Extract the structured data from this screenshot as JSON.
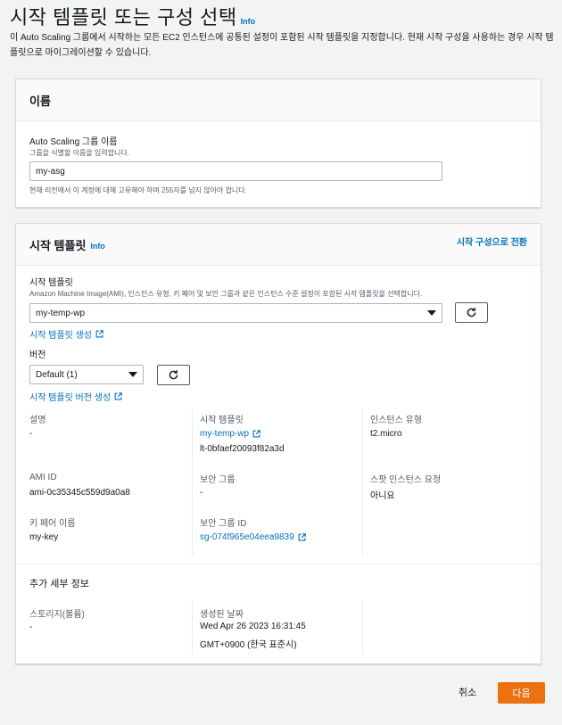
{
  "header": {
    "title": "시작 템플릿 또는 구성 선택",
    "info": "Info",
    "description": "이 Auto Scaling 그룹에서 시작하는 모든 EC2 인스턴스에 공통된 설정이 포함된 시작 템플릿을 지정합니다. 현재 시작 구성을 사용하는 경우 시작 템플릿으로 마이그레이션할 수 있습니다."
  },
  "name_panel": {
    "title": "이름",
    "field_label": "Auto Scaling 그룹 이름",
    "field_sublabel": "그룹을 식별할 이름을 입력합니다.",
    "field_value": "my-asg",
    "field_hint": "현재 리전에서 이 계정에 대해 고유해야 하며 255자를 넘지 않아야 합니다."
  },
  "template_panel": {
    "title": "시작 템플릿",
    "info": "Info",
    "switch_link": "시작 구성으로 전환",
    "template_label": "시작 템플릿",
    "template_sublabel": "Amazon Machine Image(AMI), 인스턴스 유형, 키 페어 및 보안 그룹과 같은 인스턴스 수준 설정이 포함된 시작 템플릿을 선택합니다.",
    "template_value": "my-temp-wp",
    "create_template_link": "시작 템플릿 생성",
    "version_label": "버전",
    "version_value": "Default (1)",
    "create_version_link": "시작 템플릿 버전 생성",
    "details": {
      "description_label": "설명",
      "description_value": "-",
      "launch_template_label": "시작 템플릿",
      "launch_template_name": "my-temp-wp",
      "launch_template_id": "lt-0bfaef20093f82a3d",
      "instance_type_label": "인스턴스 유형",
      "instance_type_value": "t2.micro",
      "ami_label": "AMI ID",
      "ami_value": "ami-0c35345c559d9a0a8",
      "security_groups_label": "보안 그룹",
      "security_groups_value": "-",
      "spot_label": "스팟 인스턴스 요청",
      "spot_value": "아니요",
      "key_pair_label": "키 페어 이름",
      "key_pair_value": "my-key",
      "sg_id_label": "보안 그룹 ID",
      "sg_id_value": "sg-074f965e04eea9839"
    },
    "additional": {
      "title": "추가 세부 정보",
      "storage_label": "스토리지(볼륨)",
      "storage_value": "-",
      "created_label": "생성된 날짜",
      "created_value_line1": "Wed Apr 26 2023 16:31:45",
      "created_value_line2": "GMT+0900 (한국 표준시)"
    }
  },
  "footer": {
    "cancel": "취소",
    "next": "다음"
  }
}
